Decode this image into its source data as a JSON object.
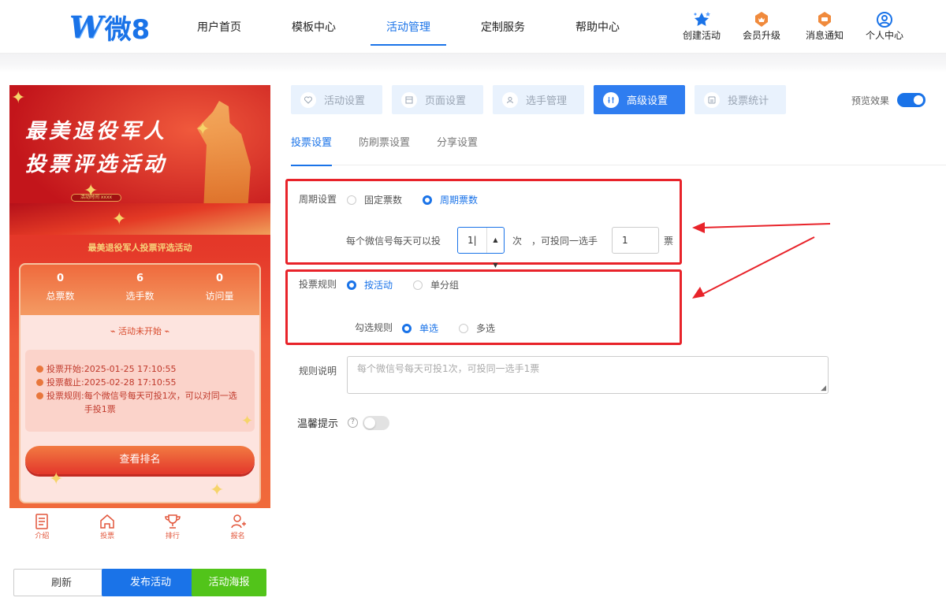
{
  "nav": {
    "logo_w": "W",
    "logo_text": "微8",
    "menu": [
      "用户首页",
      "模板中心",
      "活动管理",
      "定制服务",
      "帮助中心"
    ],
    "active_menu": "活动管理",
    "quick_links": [
      {
        "label": "创建活动",
        "icon": "star-sparkle-icon",
        "color": "#1a73e8"
      },
      {
        "label": "会员升级",
        "icon": "crown-badge-icon",
        "color": "#f08a3c"
      },
      {
        "label": "消息通知",
        "icon": "message-badge-icon",
        "color": "#f08a3c"
      },
      {
        "label": "个人中心",
        "icon": "user-circle-icon",
        "color": "#1a73e8"
      }
    ]
  },
  "preview_phone": {
    "title_line1": "最美退役军人",
    "title_line2": "投票评选活动",
    "banner_badge": "活动时间 xxxx",
    "subtitle": "最美退役军人投票评选活动",
    "stats": [
      {
        "value": "0",
        "label": "总票数"
      },
      {
        "value": "6",
        "label": "选手数"
      },
      {
        "value": "0",
        "label": "访问量"
      }
    ],
    "status": "活动未开始",
    "info": [
      {
        "label": "投票开始:",
        "value": "2025-01-25 17:10:55"
      },
      {
        "label": "投票截止:",
        "value": "2025-02-28 17:10:55"
      },
      {
        "label": "投票规则:",
        "value": "每个微信号每天可投1次，可以对同一选手投1票"
      }
    ],
    "rank_button": "查看排名",
    "tabbar": [
      {
        "label": "介绍",
        "icon": "document-icon"
      },
      {
        "label": "投票",
        "icon": "home-icon"
      },
      {
        "label": "排行",
        "icon": "trophy-icon"
      },
      {
        "label": "报名",
        "icon": "person-add-icon"
      }
    ]
  },
  "actions": {
    "refresh": "刷新",
    "publish": "发布活动",
    "poster": "活动海报"
  },
  "step_tabs": [
    {
      "label": "活动设置",
      "icon": "heart-icon"
    },
    {
      "label": "页面设置",
      "icon": "layout-icon"
    },
    {
      "label": "选手管理",
      "icon": "user-icon"
    },
    {
      "label": "高级设置",
      "icon": "sliders-icon"
    },
    {
      "label": "投票统计",
      "icon": "chart-icon"
    }
  ],
  "active_step": "高级设置",
  "preview_toggle": {
    "label": "预览效果",
    "on": true
  },
  "sub_tabs": [
    "投票设置",
    "防刷票设置",
    "分享设置"
  ],
  "active_sub_tab": "投票设置",
  "form": {
    "period": {
      "label": "周期设置",
      "options": [
        "固定票数",
        "周期票数"
      ],
      "selected": "周期票数",
      "per_day_prefix": "每个微信号每天可以投",
      "per_day_value": "1",
      "per_day_unit": "次",
      "same_player_prefix": "，可投同一选手",
      "same_player_value": "1",
      "same_player_unit": "票"
    },
    "rule": {
      "label": "投票规则",
      "options": [
        "按活动",
        "单分组"
      ],
      "selected": "按活动",
      "check_label": "勾选规则",
      "check_options": [
        "单选",
        "多选"
      ],
      "check_selected": "单选"
    },
    "description": {
      "label": "规则说明",
      "placeholder": "每个微信号每天可投1次，可投同一选手1票"
    },
    "tip": {
      "label": "温馨提示",
      "on": false
    }
  },
  "colors": {
    "accent": "#1a73e8",
    "highlight_box": "#e8232a",
    "publish": "#1a73e8",
    "poster": "#52c41a"
  }
}
